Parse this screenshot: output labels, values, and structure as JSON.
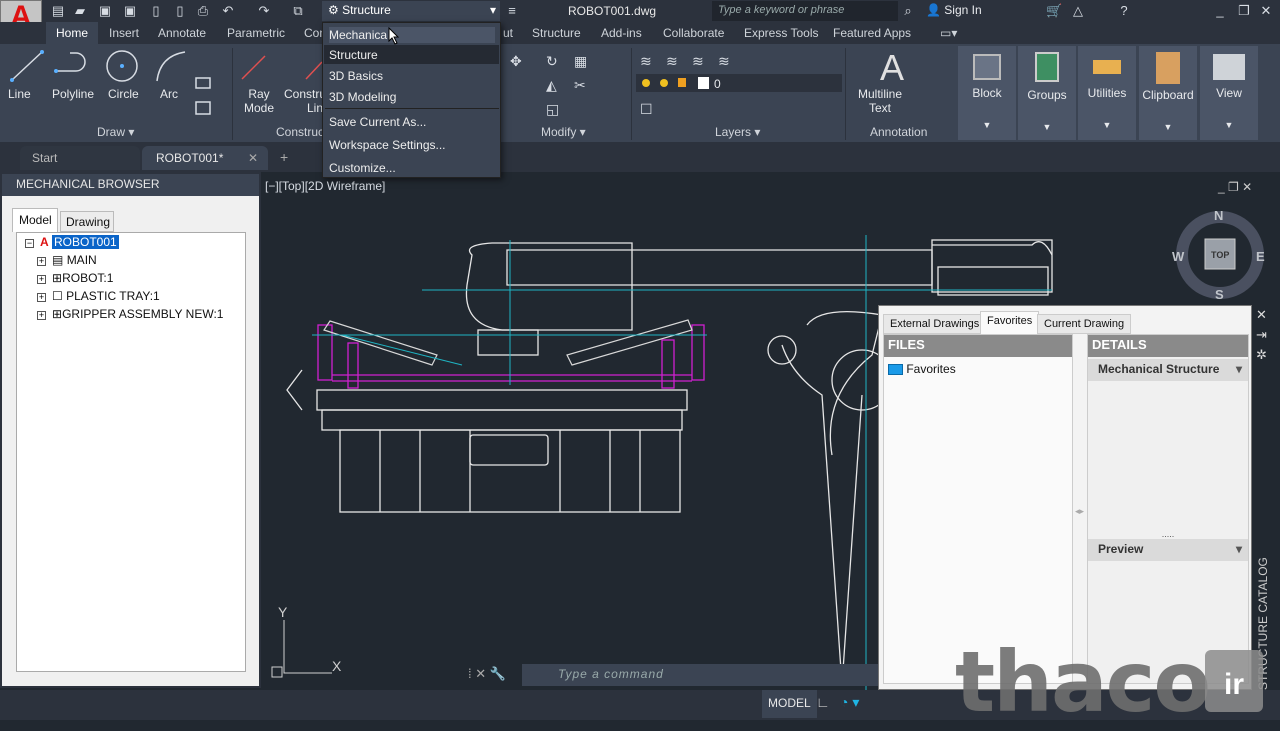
{
  "app": {
    "title": "ROBOT001.dwg",
    "workspace": "Structure",
    "search_placeholder": "Type a keyword or phrase",
    "sign_in": "Sign In",
    "logo_sub": "M"
  },
  "ribbon_tabs": [
    "Home",
    "Insert",
    "Annotate",
    "Parametric",
    "Con",
    "ut",
    "Structure",
    "Add-ins",
    "Collaborate",
    "Express Tools",
    "Featured Apps"
  ],
  "draw": {
    "line": "Line",
    "polyline": "Polyline",
    "circle": "Circle",
    "arc": "Arc",
    "panel": "Draw"
  },
  "construct": {
    "ray": "Ray",
    "mode": "Mode",
    "constru": "Constru",
    "lin": "Lin",
    "panel": "Construc"
  },
  "modify": {
    "panel": "Modify"
  },
  "layers": {
    "current": "0",
    "panel": "Layers"
  },
  "annotation": {
    "multiline": "Multiline",
    "text": "Text",
    "panel": "Annotation"
  },
  "right_panels": [
    "Block",
    "Groups",
    "Utilities",
    "Clipboard",
    "View"
  ],
  "workspace_menu": [
    "Mechanica",
    "Structure",
    "3D Basics",
    "3D Modeling",
    "Save Current As...",
    "Workspace Settings...",
    "Customize..."
  ],
  "file_tabs": {
    "start": "Start",
    "active": "ROBOT001*"
  },
  "browser": {
    "title": "MECHANICAL BROWSER",
    "tabs": [
      "Model",
      "Drawing"
    ],
    "root": "ROBOT001",
    "items": [
      "MAIN",
      "ROBOT:1",
      "PLASTIC TRAY:1",
      "GRIPPER ASSEMBLY NEW:1"
    ]
  },
  "viewport": {
    "label": "[−][Top][2D Wireframe]",
    "compass": {
      "n": "N",
      "s": "S",
      "e": "E",
      "w": "W",
      "top": "TOP"
    },
    "ucs_x": "X",
    "ucs_y": "Y"
  },
  "catalog": {
    "tabs": [
      "External Drawings",
      "Favorites",
      "Current Drawing"
    ],
    "files_header": "FILES",
    "files": [
      "Favorites"
    ],
    "details_header": "DETAILS",
    "details_dropdown": "Mechanical Structure",
    "preview": "Preview",
    "side_label": "STRUCTURE CATALOG"
  },
  "command": {
    "placeholder": "Type a command"
  },
  "status": {
    "model": "MODEL"
  },
  "watermark": {
    "text": "thaco",
    "suffix": "ir"
  },
  "colors": {
    "accent": "#3b4453",
    "drawing_cyan": "#1fb5c4",
    "drawing_magenta": "#d020d0",
    "selection": "#0a64c8"
  }
}
